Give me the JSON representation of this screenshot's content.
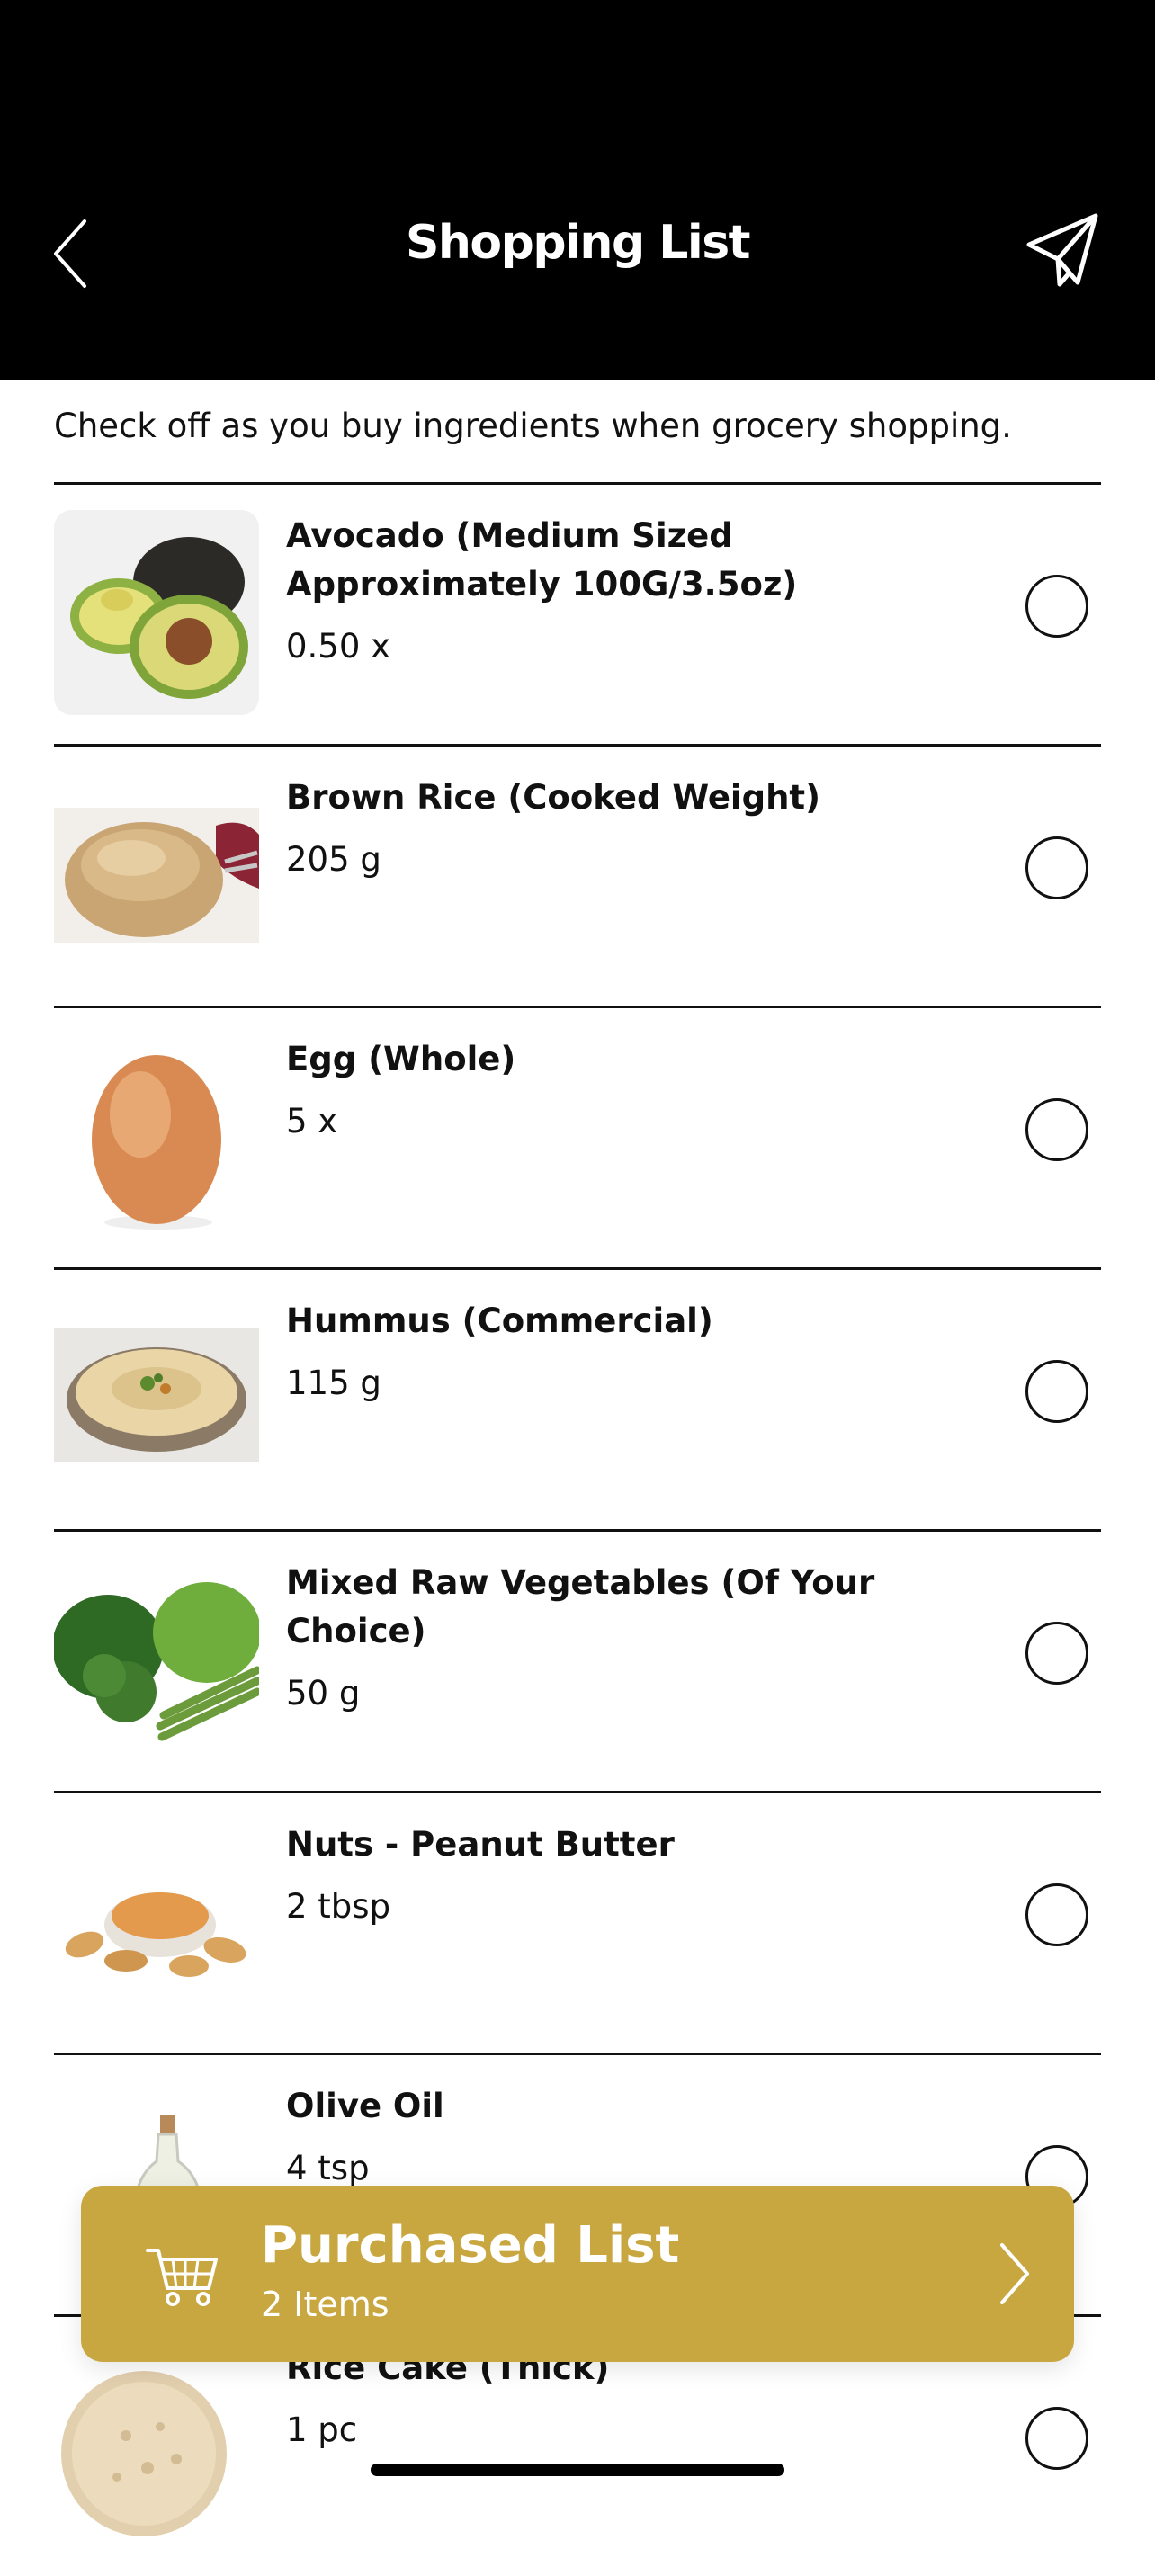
{
  "header": {
    "title": "Shopping List",
    "back_icon": "chevron-left-icon",
    "share_icon": "paper-plane-icon",
    "background": "#000000"
  },
  "subtitle": "Check off as you buy ingredients when grocery shopping.",
  "items": [
    {
      "name": "Avocado (Medium Sized Approximately 100G/3.5oz)",
      "qty": "0.50 x",
      "checked": false,
      "image": "avocado"
    },
    {
      "name": "Brown Rice (Cooked Weight)",
      "qty": "205 g",
      "checked": false,
      "image": "brown-rice"
    },
    {
      "name": "Egg (Whole)",
      "qty": "5 x",
      "checked": false,
      "image": "egg"
    },
    {
      "name": "Hummus (Commercial)",
      "qty": "115 g",
      "checked": false,
      "image": "hummus"
    },
    {
      "name": "Mixed Raw Vegetables (Of Your Choice)",
      "qty": "50 g",
      "checked": false,
      "image": "mixed-vegetables"
    },
    {
      "name": "Nuts - Peanut Butter",
      "qty": "2 tbsp",
      "checked": false,
      "image": "peanut-butter"
    },
    {
      "name": "Olive Oil",
      "qty": "4 tsp",
      "checked": false,
      "image": "olive-oil"
    },
    {
      "name": "Rice Cake (Thick)",
      "qty": "1 pc",
      "checked": false,
      "image": "rice-cake"
    }
  ],
  "purchased_bar": {
    "title": "Purchased List",
    "count": "2 Items",
    "icon": "shopping-cart-icon",
    "arrow_icon": "chevron-right-icon",
    "color": "#c9a740"
  }
}
